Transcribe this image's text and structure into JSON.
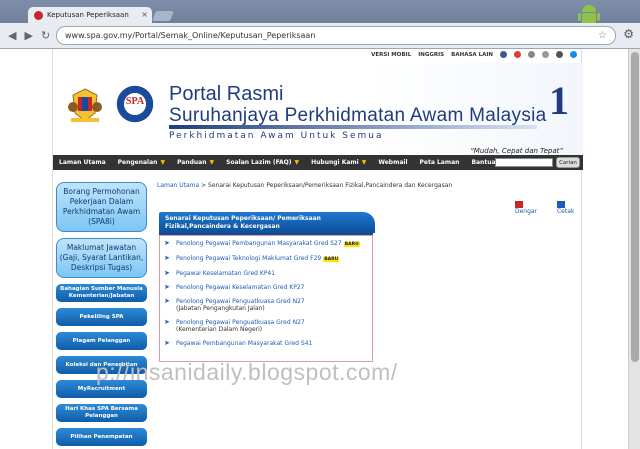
{
  "browser": {
    "tab_title": "Keputusan Peperiksaan",
    "tab_close": "×",
    "url": "www.spa.gov.my/Portal/Semak_Online/Keputusan_Peperiksaan",
    "back": "◀",
    "forward": "▶",
    "reload": "↻",
    "star": "☆",
    "wrench": "⚙"
  },
  "toplinks": [
    "VERSI MOBIL",
    "INGGRIS",
    "BAHASA LAIN"
  ],
  "header": {
    "logo_text": "SPA",
    "portal": "Portal Rasmi",
    "org": "Suruhanjaya Perkhidmatan Awam Malaysia",
    "motto": "Perkhidmatan Awam Untuk Semua",
    "slogan": "“Mudah, Cepat dan Tepat”",
    "one": "1"
  },
  "menu": [
    {
      "label": "Laman Utama",
      "dd": false
    },
    {
      "label": "Pengenalan",
      "dd": true
    },
    {
      "label": "Panduan",
      "dd": true
    },
    {
      "label": "Soalan Lazim (FAQ)",
      "dd": true
    },
    {
      "label": "Hubungi Kami",
      "dd": true
    },
    {
      "label": "Webmail",
      "dd": false
    },
    {
      "label": "Peta Laman",
      "dd": false
    },
    {
      "label": "Bantuan",
      "dd": false
    }
  ],
  "menu_dropdown_glyph": "▼",
  "search_button": "Carian",
  "sidebar": {
    "big": [
      "Borang Permohonan Pekerjaan Dalam Perkhidmatan Awam (SPA8i)",
      "Maklumat Jawatan (Gaji, Syarat Lantikan, Deskripsi Tugas)"
    ],
    "small": [
      "Bahagian Sumber Manusia Kementerian/Jabatan",
      "Pekeliling SPA",
      "Piagam Pelanggan",
      "Koleksi dan Penerbitan",
      "MyRecruitment",
      "Hari Khas SPA Bersama Pelanggan",
      "Pilihan Penempatan"
    ]
  },
  "breadcrumb": {
    "home": "Laman Utama",
    "rest": " > Senarai Keputusan Peperiksaan/Pemeriksaan Fizikal,Pancaindera dan Kecergasan"
  },
  "tools": {
    "listen": "Dengar",
    "print": "Cetak"
  },
  "section_title": "Senarai Keputusan Peperiksaan/ Pemeriksaan Fizikal,Pancaindera & Kecergasan",
  "arrow_glyph": "➤",
  "results": [
    {
      "label": "Penolong Pegawai Pembangunan Masyarakat Gred S27",
      "sub": "",
      "baru": "BARU"
    },
    {
      "label": "Penolong Pegawai Teknologi Maklumat Gred F29",
      "sub": "",
      "baru": "BARU"
    },
    {
      "label": "Pegawai Keselamatan Gred KP41",
      "sub": "",
      "baru": ""
    },
    {
      "label": "Penolong Pegawai Keselamatan Gred KP27",
      "sub": "",
      "baru": ""
    },
    {
      "label": "Penolong Pegawai Penguatkuasa Gred N27",
      "sub": "(Jabatan Pengangkutan Jalan)",
      "baru": ""
    },
    {
      "label": "Penolong Pegawai Penguatkuasa Gred N27",
      "sub": "(Kementerian Dalam Negeri)",
      "baru": ""
    },
    {
      "label": "Pegawai Pembangunan Masyarakat Gred S41",
      "sub": "",
      "baru": ""
    }
  ],
  "watermark": "p://insanidaily.blogspot.com/"
}
